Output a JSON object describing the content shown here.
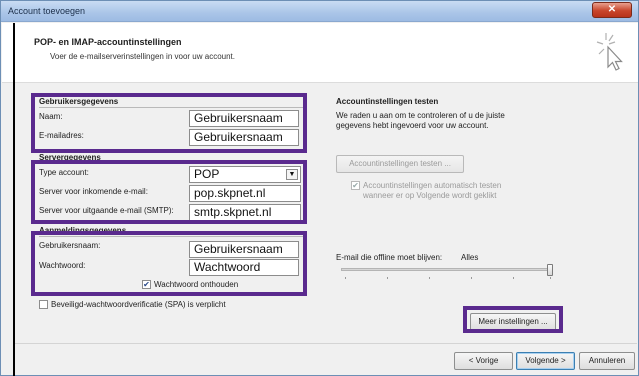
{
  "window": {
    "title": "Account toevoegen",
    "close_glyph": "✕"
  },
  "header": {
    "title": "POP- en IMAP-accountinstellingen",
    "subtitle": "Voer de e-mailserverinstellingen in voor uw account.",
    "icon": "sparkle-cursor-icon"
  },
  "user_info": {
    "heading": "Gebruikersgegevens",
    "name_label": "Naam:",
    "name_value": "Gebruikersnaam",
    "email_label": "E-mailadres:",
    "email_value": "Gebruikersnaam"
  },
  "server_info": {
    "heading": "Servergegevens",
    "account_type_label": "Type account:",
    "account_type_value": "POP",
    "incoming_label": "Server voor inkomende e-mail:",
    "incoming_value": "pop.skpnet.nl",
    "outgoing_label": "Server voor uitgaande e-mail (SMTP):",
    "outgoing_value": "smtp.skpnet.nl"
  },
  "login_info": {
    "heading": "Aanmeldingsgegevens",
    "username_label": "Gebruikersnaam:",
    "username_value": "Gebruikersnaam",
    "password_label": "Wachtwoord:",
    "password_value": "Wachtwoord",
    "remember_label": "Wachtwoord onthouden",
    "remember_checked": true,
    "spa_label": "Beveiligd-wachtwoordverificatie (SPA) is verplicht",
    "spa_checked": false
  },
  "test_settings": {
    "heading": "Accountinstellingen testen",
    "description": "We raden u aan om te controleren of u de juiste gegevens hebt ingevoerd voor uw account.",
    "test_button": "Accountinstellingen testen ...",
    "auto_test_label": "Accountinstellingen automatisch testen wanneer er op Volgende wordt geklikt",
    "auto_test_checked": true
  },
  "offline": {
    "label": "E-mail die offline moet blijven:",
    "value": "Alles",
    "slider_fraction": 1.0
  },
  "buttons": {
    "more_settings": "Meer instellingen ...",
    "back": "< Vorige",
    "next": "Volgende >",
    "cancel": "Annuleren"
  },
  "colors": {
    "highlight_box": "#5a2a8e",
    "title_bar": "#aac5e8",
    "close_button": "#c8452b"
  }
}
